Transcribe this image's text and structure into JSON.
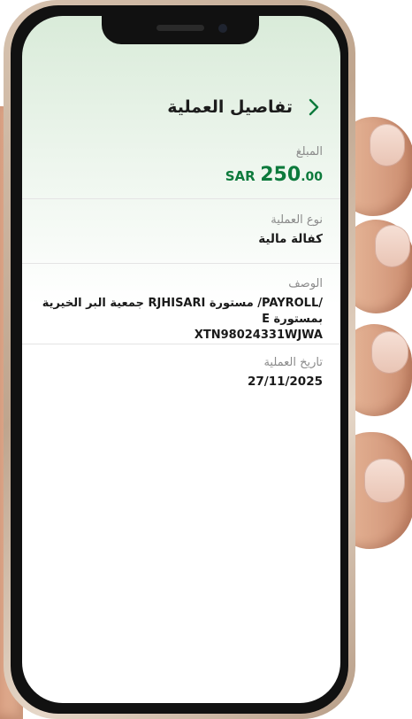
{
  "screen": {
    "title": "تفاصيل العملية"
  },
  "fields": {
    "amount": {
      "label": "المبلغ",
      "currency": "SAR",
      "integer": "250",
      "decimal": ".00"
    },
    "type": {
      "label": "نوع العملية",
      "value": "كفالة مالية"
    },
    "description": {
      "label": "الوصف",
      "line1": "/PAYROLL/ مستورة RJHISARI جمعية البر الخيرية بمستورة E",
      "line2": "XTN98024331WJWA"
    },
    "date": {
      "label": "تاريخ العملية",
      "value": "27/11/2025"
    }
  },
  "colors": {
    "accent": "#0d7a3c",
    "back_chevron": "#0d7a3c"
  },
  "icons": {
    "back": "chevron-right-icon"
  }
}
